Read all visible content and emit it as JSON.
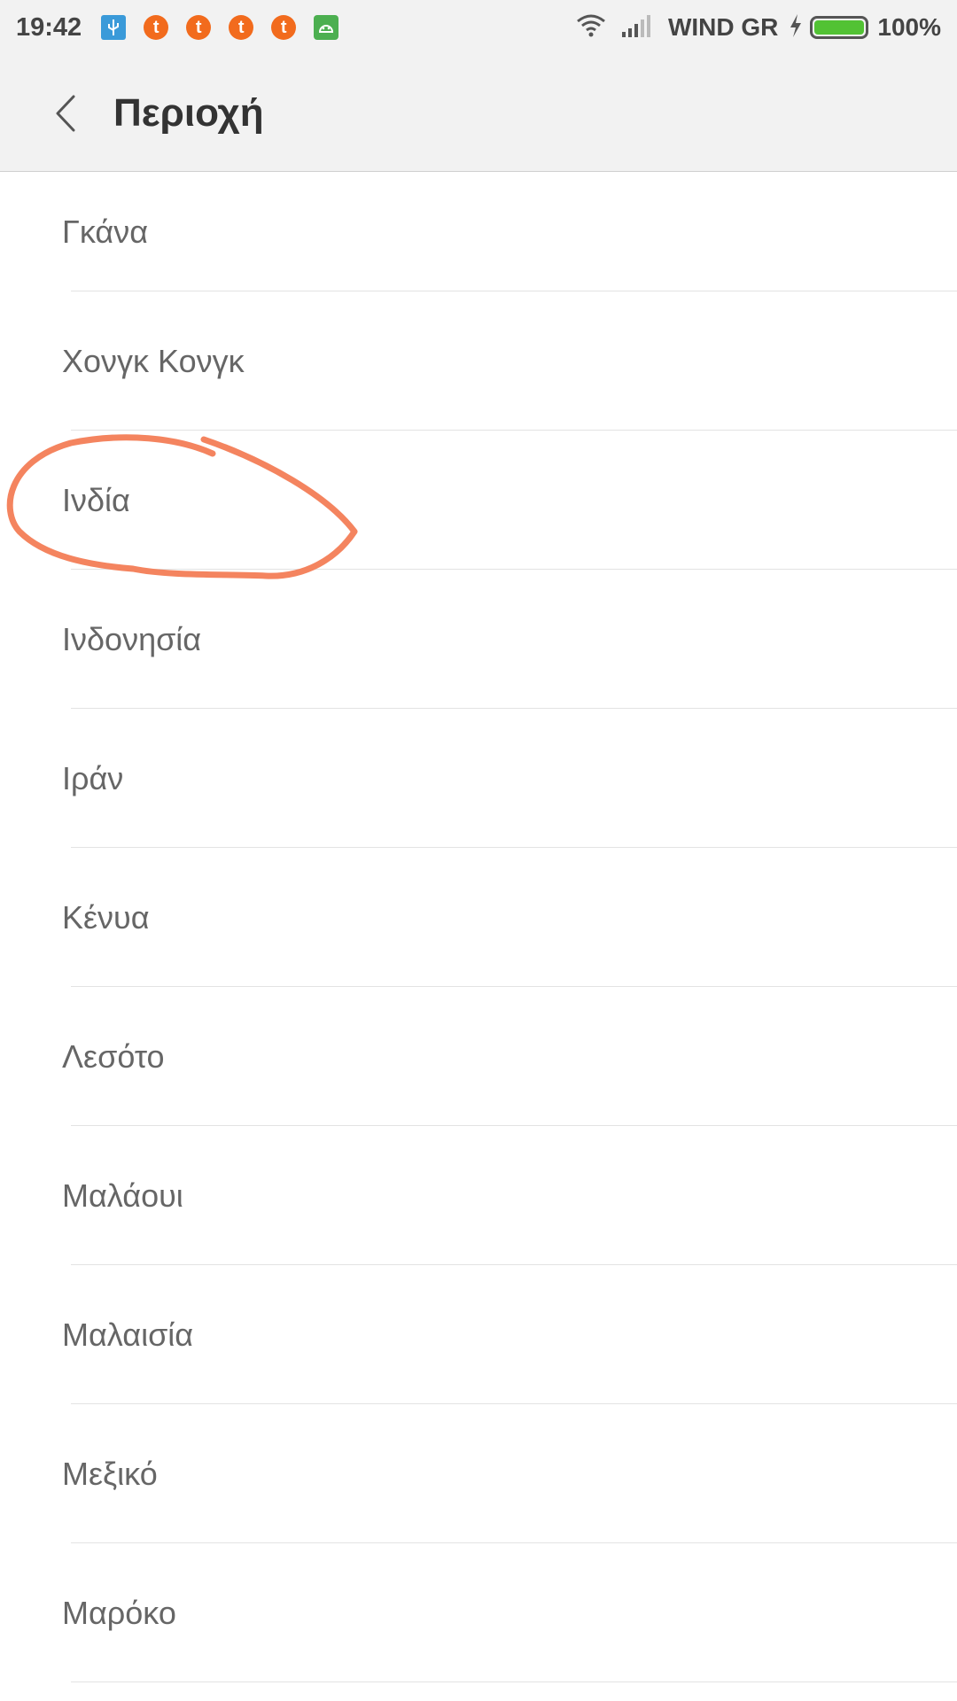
{
  "status_bar": {
    "time": "19:42",
    "notification_icons": [
      "usb-icon",
      "t-app-icon",
      "t-app-icon",
      "t-app-icon",
      "t-app-icon",
      "android-icon"
    ],
    "carrier": "WIND GR",
    "battery_percent": "100%",
    "battery_level": 1.0
  },
  "header": {
    "title": "Περιοχή"
  },
  "regions": [
    {
      "label": "Γκάνα"
    },
    {
      "label": "Χονγκ Κονγκ"
    },
    {
      "label": "Ινδία"
    },
    {
      "label": "Ινδονησία"
    },
    {
      "label": "Ιράν"
    },
    {
      "label": "Κένυα"
    },
    {
      "label": "Λεσότο"
    },
    {
      "label": "Μαλάουι"
    },
    {
      "label": "Μαλαισία"
    },
    {
      "label": "Μεξικό"
    },
    {
      "label": "Μαρόκο"
    }
  ],
  "colors": {
    "annotation": "#f4845f",
    "battery": "#52c234",
    "notif_t": "#f26b1d",
    "notif_usb": "#3a9ad9",
    "notif_android": "#4caf50"
  }
}
